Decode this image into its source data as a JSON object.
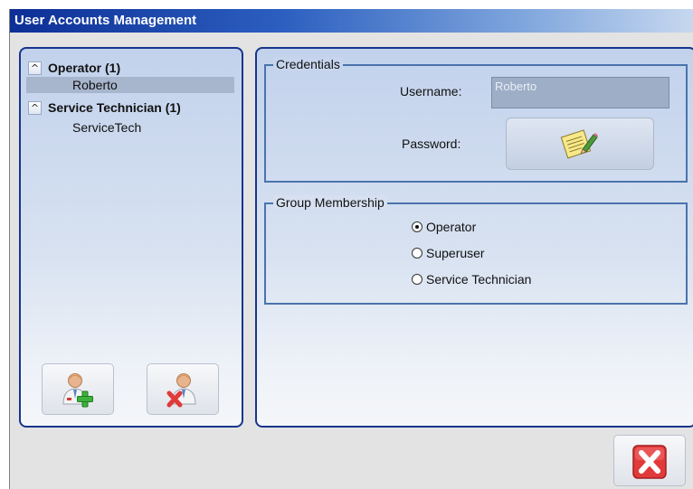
{
  "window": {
    "title": "User Accounts Management"
  },
  "user_tree": {
    "groups": [
      {
        "label": "Operator (1)",
        "toggle": "^",
        "users": [
          "Roberto"
        ]
      },
      {
        "label": "Service Technician (1)",
        "toggle": "^",
        "users": [
          "ServiceTech"
        ]
      }
    ],
    "selected_user": "Roberto"
  },
  "actions": {
    "add_user_icon": "add-user-icon",
    "remove_user_icon": "remove-user-icon",
    "close_icon": "close-icon"
  },
  "credentials": {
    "legend": "Credentials",
    "username_label": "Username:",
    "username_value": "Roberto",
    "password_label": "Password:",
    "password_icon": "edit-password-icon"
  },
  "group_membership": {
    "legend": "Group Membership",
    "options": [
      "Operator",
      "Superuser",
      "Service Technician"
    ],
    "selected": "Operator"
  },
  "colors": {
    "title_bar_start": "#0d2f96",
    "panel_border": "#17358d",
    "fieldset_border": "#4a73ad",
    "selection": "#a7b5cd",
    "close_red": "#e03a3a",
    "add_green": "#3cb23c"
  }
}
